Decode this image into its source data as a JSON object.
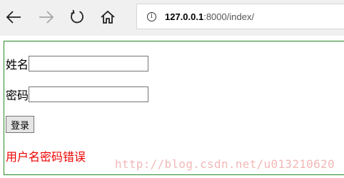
{
  "browser": {
    "url_host": "127.0.0.1",
    "url_rest": ":8000/index/",
    "info_icon_glyph": "i"
  },
  "form": {
    "name_label": "姓名",
    "password_label": "密码",
    "name_value": "",
    "password_value": "",
    "login_button": "登录",
    "error_message": "用户名密码错误"
  },
  "watermark": "http://blog.csdn.net/u013210620",
  "colors": {
    "error": "#ee0000",
    "container_border": "#2a8a2a",
    "watermark": "#f2b8b8"
  }
}
